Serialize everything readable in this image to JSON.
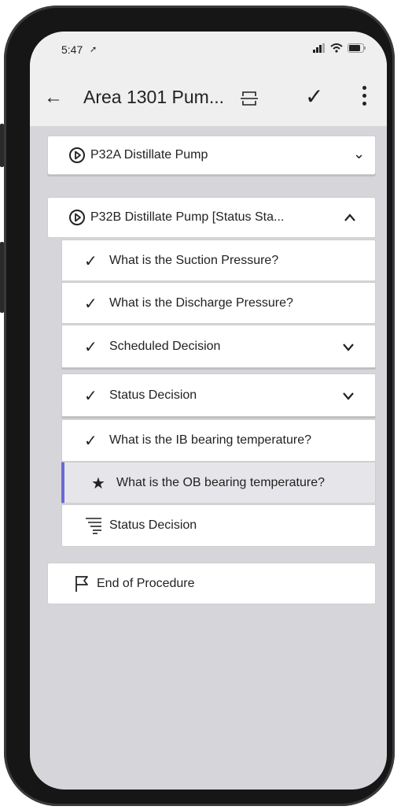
{
  "status_bar": {
    "time": "5:47"
  },
  "app_bar": {
    "title": "Area 1301 Pum..."
  },
  "sections": [
    {
      "label": "P32A Distillate Pump",
      "expanded": false
    },
    {
      "label": "P32B Distillate Pump [Status Sta...",
      "expanded": true,
      "items": [
        {
          "label": "What is the Suction Pressure?",
          "state": "done"
        },
        {
          "label": "What is the Discharge Pressure?",
          "state": "done"
        },
        {
          "label": "Scheduled Decision",
          "state": "done",
          "expandable": true
        },
        {
          "label": "Status Decision",
          "state": "done",
          "expandable": true
        },
        {
          "label": "What is the IB bearing temperature?",
          "state": "done"
        },
        {
          "label": "What is the OB bearing temperature?",
          "state": "current"
        },
        {
          "label": "Status Decision",
          "state": "pending"
        }
      ]
    }
  ],
  "end": {
    "label": "End of Procedure"
  },
  "colors": {
    "accent": "#6a68d8",
    "screen_bg": "#d6d5da",
    "bar_bg": "#efefef"
  }
}
